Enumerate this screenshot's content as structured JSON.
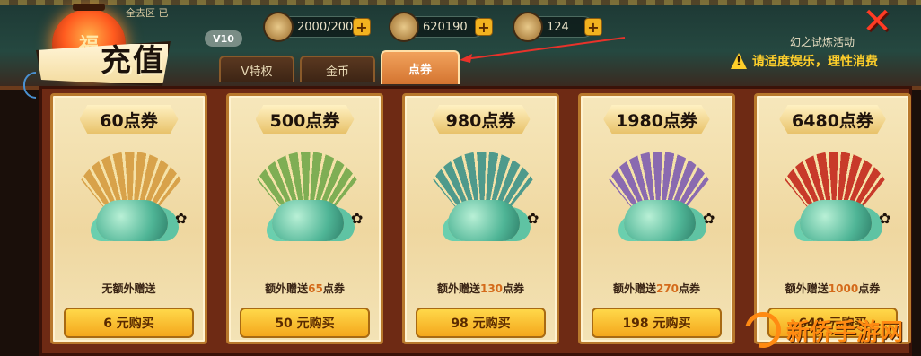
{
  "header": {
    "lantern_glyph": "福",
    "player_name": "全去区 已",
    "vip": "V10",
    "title": "充值",
    "resources": [
      {
        "name": "stamina",
        "value": "2000/200"
      },
      {
        "name": "coins",
        "value": "620190"
      },
      {
        "name": "vouchers",
        "value": "124"
      }
    ],
    "plus_label": "+",
    "close_label": "✕",
    "event_label": "幻之试炼活动",
    "notice": "请适度娱乐，理性消费"
  },
  "tabs": [
    {
      "label": "V特权",
      "active": false
    },
    {
      "label": "金币",
      "active": false
    },
    {
      "label": "点券",
      "active": true
    }
  ],
  "cards": [
    {
      "price": "60点券",
      "bonus_prefix": "无额外赠送",
      "bonus_amount": "",
      "bonus_suffix": "",
      "buy": "6 元购买",
      "fan_color": "#d8a24a"
    },
    {
      "price": "500点券",
      "bonus_prefix": "额外赠送",
      "bonus_amount": "65",
      "bonus_suffix": "点券",
      "buy": "50 元购买",
      "fan_color": "#7fae54"
    },
    {
      "price": "980点券",
      "bonus_prefix": "额外赠送",
      "bonus_amount": "130",
      "bonus_suffix": "点券",
      "buy": "98 元购买",
      "fan_color": "#4f9a8c"
    },
    {
      "price": "1980点券",
      "bonus_prefix": "额外赠送",
      "bonus_amount": "270",
      "bonus_suffix": "点券",
      "buy": "198 元购买",
      "fan_color": "#8a6ab0"
    },
    {
      "price": "6480点券",
      "bonus_prefix": "额外赠送",
      "bonus_amount": "1000",
      "bonus_suffix": "点券",
      "buy": "648 元购买",
      "fan_color": "#c83a2a"
    }
  ],
  "watermark": "新侨手游网",
  "colors": {
    "accent": "#f4a71c",
    "panel": "#6e2a14",
    "highlight": "#d46a1a"
  }
}
